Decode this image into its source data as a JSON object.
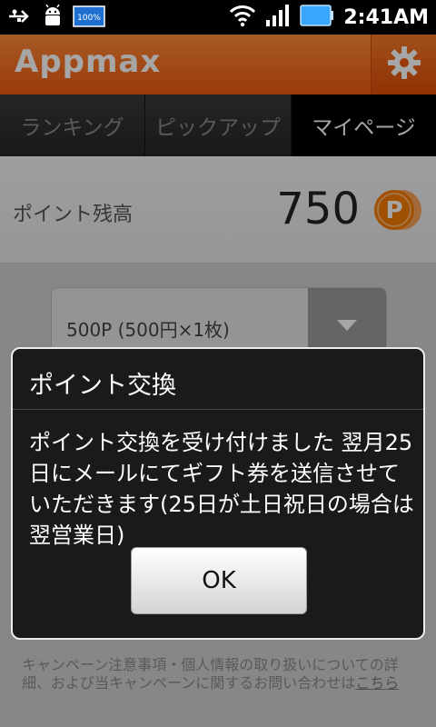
{
  "status_bar": {
    "battery_badge": "100%",
    "time": "2:41AM"
  },
  "app": {
    "logo": "Appmax",
    "settings_icon": "gear-icon"
  },
  "tabs": [
    {
      "label": "ランキング",
      "selected": false
    },
    {
      "label": "ピックアップ",
      "selected": false
    },
    {
      "label": "マイページ",
      "selected": true
    }
  ],
  "points": {
    "label": "ポイント残高",
    "value": "750",
    "coin_letter": "P"
  },
  "exchange": {
    "selected_option": "500P (500円×1枚)"
  },
  "footer": {
    "note": "キャンペーン注意事項・個人情報の取り扱いについての詳細、および当キャンペーンに関するお問い合わせは",
    "link": "こちら"
  },
  "dialog": {
    "title": "ポイント交換",
    "message": "ポイント交換を受け付けました 翌月25日にメールにてギフト券を送信させていただきます(25日が土日祝日の場合は翌営業日)",
    "ok_label": "OK"
  },
  "colors": {
    "brand_orange": "#f26a1b",
    "coin_orange": "#f57c00"
  }
}
